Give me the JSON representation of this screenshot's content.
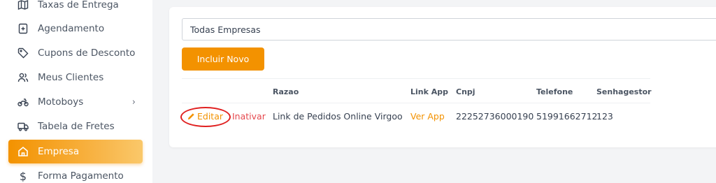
{
  "sidebar": {
    "items": [
      {
        "label": "Taxas de Entrega",
        "icon": "map-icon"
      },
      {
        "label": "Agendamento",
        "icon": "calendar-plus-icon"
      },
      {
        "label": "Cupons de Desconto",
        "icon": "tag-icon"
      },
      {
        "label": "Meus Clientes",
        "icon": "users-icon"
      },
      {
        "label": "Motoboys",
        "icon": "motorcycle-icon"
      },
      {
        "label": "Tabela de Fretes",
        "icon": "truck-icon"
      },
      {
        "label": "Empresa",
        "icon": "home-icon",
        "active": true
      },
      {
        "label": "Forma Pagamento",
        "icon": "dollar-icon"
      }
    ]
  },
  "main": {
    "company_select": "Todas Empresas",
    "add_button": "Incluir Novo",
    "table": {
      "headers": [
        "Razao",
        "Link App",
        "Cnpj",
        "Telefone",
        "Senhagestor"
      ],
      "rows": [
        {
          "edit": "Editar",
          "deactivate": "Inativar",
          "razao": "Link de Pedidos Online Virgoo",
          "link_app": "Ver App",
          "cnpj": "22252736000190",
          "telefone": "51991662712",
          "senhagestor": "123"
        }
      ]
    }
  },
  "colors": {
    "accent": "#f39200",
    "danger": "#e5484d",
    "annotation": "#e02020"
  }
}
